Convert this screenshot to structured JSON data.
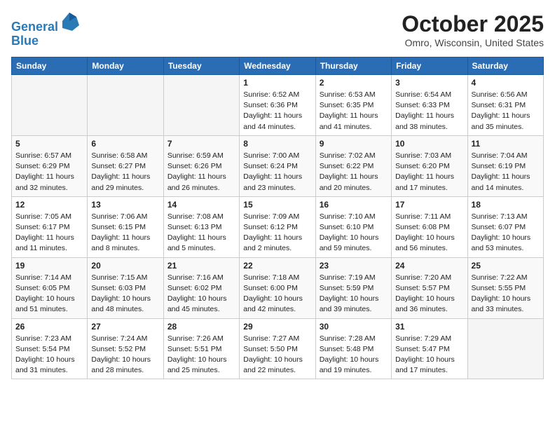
{
  "header": {
    "logo_line1": "General",
    "logo_line2": "Blue",
    "month_title": "October 2025",
    "location": "Omro, Wisconsin, United States"
  },
  "weekdays": [
    "Sunday",
    "Monday",
    "Tuesday",
    "Wednesday",
    "Thursday",
    "Friday",
    "Saturday"
  ],
  "weeks": [
    [
      {
        "day": "",
        "info": ""
      },
      {
        "day": "",
        "info": ""
      },
      {
        "day": "",
        "info": ""
      },
      {
        "day": "1",
        "info": "Sunrise: 6:52 AM\nSunset: 6:36 PM\nDaylight: 11 hours\nand 44 minutes."
      },
      {
        "day": "2",
        "info": "Sunrise: 6:53 AM\nSunset: 6:35 PM\nDaylight: 11 hours\nand 41 minutes."
      },
      {
        "day": "3",
        "info": "Sunrise: 6:54 AM\nSunset: 6:33 PM\nDaylight: 11 hours\nand 38 minutes."
      },
      {
        "day": "4",
        "info": "Sunrise: 6:56 AM\nSunset: 6:31 PM\nDaylight: 11 hours\nand 35 minutes."
      }
    ],
    [
      {
        "day": "5",
        "info": "Sunrise: 6:57 AM\nSunset: 6:29 PM\nDaylight: 11 hours\nand 32 minutes."
      },
      {
        "day": "6",
        "info": "Sunrise: 6:58 AM\nSunset: 6:27 PM\nDaylight: 11 hours\nand 29 minutes."
      },
      {
        "day": "7",
        "info": "Sunrise: 6:59 AM\nSunset: 6:26 PM\nDaylight: 11 hours\nand 26 minutes."
      },
      {
        "day": "8",
        "info": "Sunrise: 7:00 AM\nSunset: 6:24 PM\nDaylight: 11 hours\nand 23 minutes."
      },
      {
        "day": "9",
        "info": "Sunrise: 7:02 AM\nSunset: 6:22 PM\nDaylight: 11 hours\nand 20 minutes."
      },
      {
        "day": "10",
        "info": "Sunrise: 7:03 AM\nSunset: 6:20 PM\nDaylight: 11 hours\nand 17 minutes."
      },
      {
        "day": "11",
        "info": "Sunrise: 7:04 AM\nSunset: 6:19 PM\nDaylight: 11 hours\nand 14 minutes."
      }
    ],
    [
      {
        "day": "12",
        "info": "Sunrise: 7:05 AM\nSunset: 6:17 PM\nDaylight: 11 hours\nand 11 minutes."
      },
      {
        "day": "13",
        "info": "Sunrise: 7:06 AM\nSunset: 6:15 PM\nDaylight: 11 hours\nand 8 minutes."
      },
      {
        "day": "14",
        "info": "Sunrise: 7:08 AM\nSunset: 6:13 PM\nDaylight: 11 hours\nand 5 minutes."
      },
      {
        "day": "15",
        "info": "Sunrise: 7:09 AM\nSunset: 6:12 PM\nDaylight: 11 hours\nand 2 minutes."
      },
      {
        "day": "16",
        "info": "Sunrise: 7:10 AM\nSunset: 6:10 PM\nDaylight: 10 hours\nand 59 minutes."
      },
      {
        "day": "17",
        "info": "Sunrise: 7:11 AM\nSunset: 6:08 PM\nDaylight: 10 hours\nand 56 minutes."
      },
      {
        "day": "18",
        "info": "Sunrise: 7:13 AM\nSunset: 6:07 PM\nDaylight: 10 hours\nand 53 minutes."
      }
    ],
    [
      {
        "day": "19",
        "info": "Sunrise: 7:14 AM\nSunset: 6:05 PM\nDaylight: 10 hours\nand 51 minutes."
      },
      {
        "day": "20",
        "info": "Sunrise: 7:15 AM\nSunset: 6:03 PM\nDaylight: 10 hours\nand 48 minutes."
      },
      {
        "day": "21",
        "info": "Sunrise: 7:16 AM\nSunset: 6:02 PM\nDaylight: 10 hours\nand 45 minutes."
      },
      {
        "day": "22",
        "info": "Sunrise: 7:18 AM\nSunset: 6:00 PM\nDaylight: 10 hours\nand 42 minutes."
      },
      {
        "day": "23",
        "info": "Sunrise: 7:19 AM\nSunset: 5:59 PM\nDaylight: 10 hours\nand 39 minutes."
      },
      {
        "day": "24",
        "info": "Sunrise: 7:20 AM\nSunset: 5:57 PM\nDaylight: 10 hours\nand 36 minutes."
      },
      {
        "day": "25",
        "info": "Sunrise: 7:22 AM\nSunset: 5:55 PM\nDaylight: 10 hours\nand 33 minutes."
      }
    ],
    [
      {
        "day": "26",
        "info": "Sunrise: 7:23 AM\nSunset: 5:54 PM\nDaylight: 10 hours\nand 31 minutes."
      },
      {
        "day": "27",
        "info": "Sunrise: 7:24 AM\nSunset: 5:52 PM\nDaylight: 10 hours\nand 28 minutes."
      },
      {
        "day": "28",
        "info": "Sunrise: 7:26 AM\nSunset: 5:51 PM\nDaylight: 10 hours\nand 25 minutes."
      },
      {
        "day": "29",
        "info": "Sunrise: 7:27 AM\nSunset: 5:50 PM\nDaylight: 10 hours\nand 22 minutes."
      },
      {
        "day": "30",
        "info": "Sunrise: 7:28 AM\nSunset: 5:48 PM\nDaylight: 10 hours\nand 19 minutes."
      },
      {
        "day": "31",
        "info": "Sunrise: 7:29 AM\nSunset: 5:47 PM\nDaylight: 10 hours\nand 17 minutes."
      },
      {
        "day": "",
        "info": ""
      }
    ]
  ]
}
